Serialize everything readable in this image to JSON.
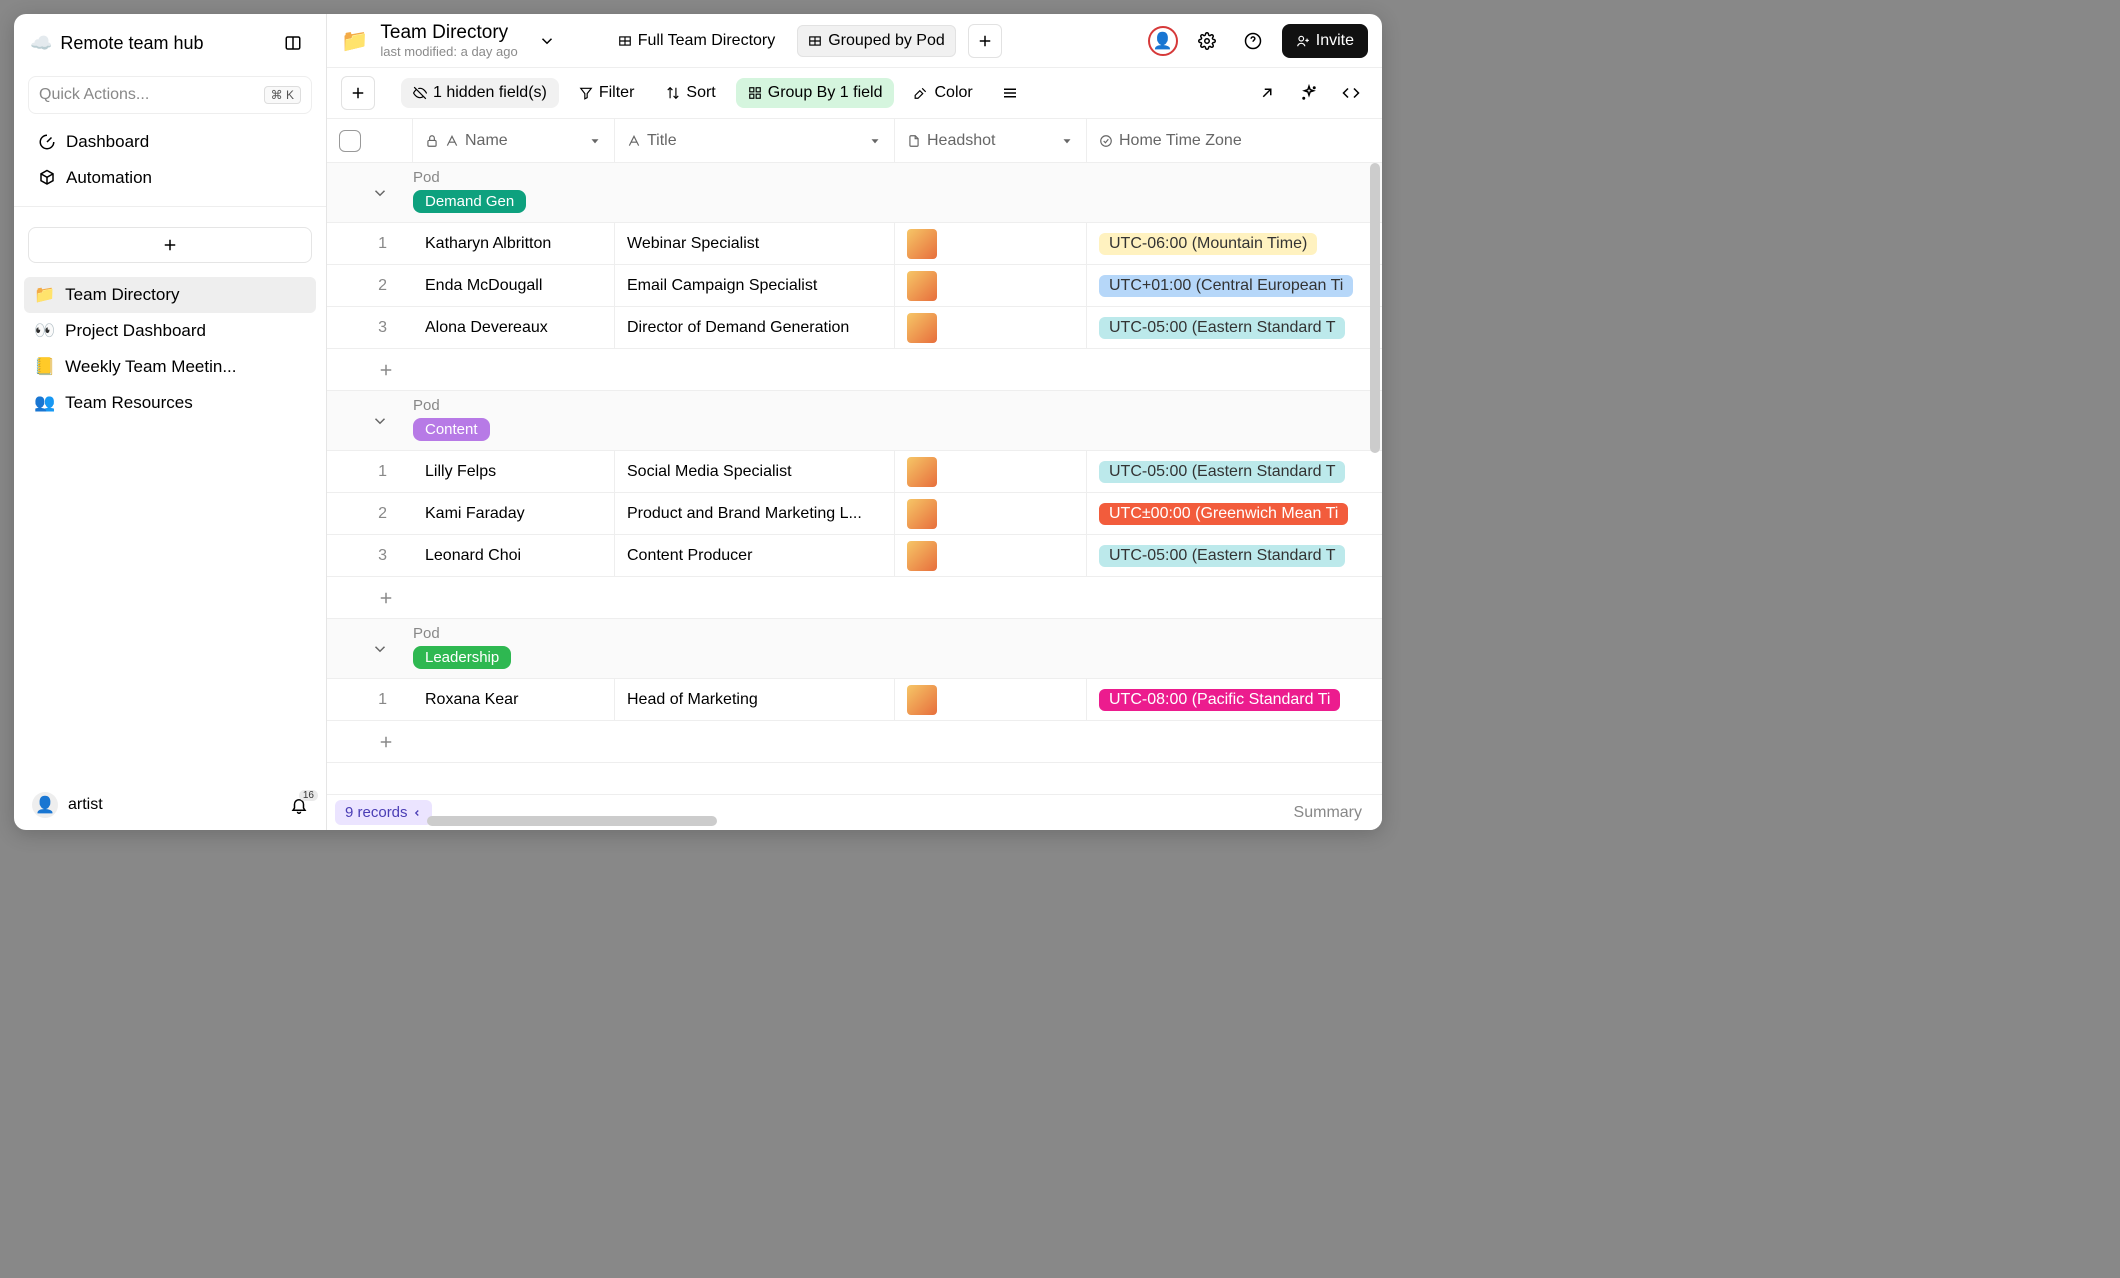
{
  "sidebar": {
    "workspace_title": "Remote team hub",
    "search_placeholder": "Quick Actions...",
    "search_shortcut": "⌘ K",
    "nav": [
      {
        "label": "Dashboard",
        "icon": "gauge"
      },
      {
        "label": "Automation",
        "icon": "cube"
      }
    ],
    "docs": [
      {
        "label": "Team Directory",
        "icon": "📁",
        "active": true
      },
      {
        "label": "Project Dashboard",
        "icon": "👀"
      },
      {
        "label": "Weekly Team Meetin...",
        "icon": "📒"
      },
      {
        "label": "Team Resources",
        "icon": "👥"
      }
    ],
    "user": "artist",
    "notif_count": "16"
  },
  "header": {
    "doc_title": "Team Directory",
    "doc_sub": "last modified: a day ago",
    "views": [
      {
        "label": "Full Team Directory",
        "active": false
      },
      {
        "label": "Grouped by Pod",
        "active": true
      }
    ],
    "invite": "Invite"
  },
  "toolbar": {
    "hidden_fields": "1 hidden field(s)",
    "filter": "Filter",
    "sort": "Sort",
    "group_by": "Group By 1 field",
    "color": "Color"
  },
  "columns": {
    "name": "Name",
    "title": "Title",
    "headshot": "Headshot",
    "timezone": "Home Time Zone",
    "group_label": "Pod"
  },
  "tz_colors": {
    "mt": {
      "bg": "#fff2c0",
      "fg": "#333"
    },
    "cet": {
      "bg": "#b6d7f9",
      "fg": "#333"
    },
    "est": {
      "bg": "#bce9eb",
      "fg": "#333"
    },
    "gmt": {
      "bg": "#f25c3c",
      "fg": "#fff"
    },
    "pst": {
      "bg": "#ec1c8e",
      "fg": "#fff"
    }
  },
  "groups": [
    {
      "pod": "Demand Gen",
      "pod_color": "#0ea17e",
      "rows": [
        {
          "num": "1",
          "name": "Katharyn Albritton",
          "title": "Webinar Specialist",
          "tz": "UTC-06:00 (Mountain Time)",
          "tz_key": "mt"
        },
        {
          "num": "2",
          "name": "Enda McDougall",
          "title": "Email Campaign Specialist",
          "tz": "UTC+01:00 (Central European Ti",
          "tz_key": "cet"
        },
        {
          "num": "3",
          "name": "Alona Devereaux",
          "title": "Director of Demand Generation",
          "tz": "UTC-05:00 (Eastern Standard T",
          "tz_key": "est"
        }
      ]
    },
    {
      "pod": "Content",
      "pod_color": "#b77ae6",
      "rows": [
        {
          "num": "1",
          "name": "Lilly Felps",
          "title": "Social Media Specialist",
          "tz": "UTC-05:00 (Eastern Standard T",
          "tz_key": "est"
        },
        {
          "num": "2",
          "name": "Kami Faraday",
          "title": "Product and Brand Marketing L...",
          "tz": "UTC±00:00 (Greenwich Mean Ti",
          "tz_key": "gmt"
        },
        {
          "num": "3",
          "name": "Leonard Choi",
          "title": "Content Producer",
          "tz": "UTC-05:00 (Eastern Standard T",
          "tz_key": "est"
        }
      ]
    },
    {
      "pod": "Leadership",
      "pod_color": "#2eb851",
      "rows": [
        {
          "num": "1",
          "name": "Roxana Kear",
          "title": "Head of Marketing",
          "tz": "UTC-08:00 (Pacific Standard Ti",
          "tz_key": "pst"
        }
      ]
    }
  ],
  "footer": {
    "records": "9 records",
    "summary": "Summary"
  }
}
